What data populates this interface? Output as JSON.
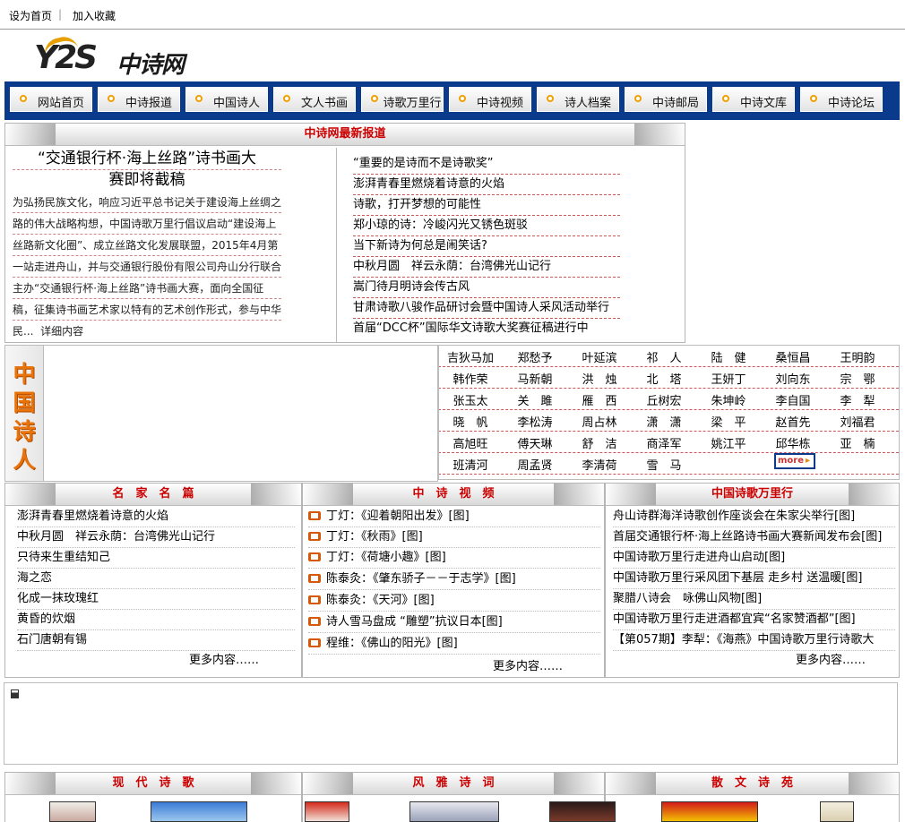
{
  "topbar": {
    "set_home": "设为首页",
    "sep": "|",
    "favorite": "加入收藏"
  },
  "logo": {
    "latin": "Y2S",
    "chinese": "中诗网"
  },
  "nav": [
    "网站首页",
    "中诗报道",
    "中国诗人",
    "文人书画",
    "诗歌万里行",
    "中诗视频",
    "诗人档案",
    "中诗邮局",
    "中诗文库",
    "中诗论坛"
  ],
  "news": {
    "title": "中诗网最新报道",
    "feature_title_1": "“交通银行杯·海上丝路”诗书画大",
    "feature_title_2": "赛即将截稿",
    "feature_lines": [
      "为弘扬民族文化，响应习近平总书记关于建设海上丝绸之",
      "路的伟大战略构想，中国诗歌万里行倡议启动“建设海上",
      "丝路新文化圈”、成立丝路文化发展联盟，2015年4月第",
      "一站走进舟山，并与交通银行股份有限公司舟山分行联合",
      "主办“交通银行杯·海上丝路”诗书画大赛，面向全国征",
      "稿，征集诗书画艺术家以特有的艺术创作形式，参与中华",
      "民..."
    ],
    "detail": "详细内容",
    "list": [
      "“重要的是诗而不是诗歌奖”",
      "澎湃青春里燃烧着诗意的火焰",
      "诗歌，打开梦想的可能性",
      "郑小琼的诗：冷峻闪光又锈色斑驳",
      "当下新诗为何总是闹笑话?",
      "中秋月圆　祥云永荫：台湾佛光山记行",
      "嵩门待月明诗会传古风",
      "甘肃诗歌八骏作品研讨会暨中国诗人采风活动举行",
      "首届“DCC杯”国际华文诗歌大奖赛征稿进行中"
    ]
  },
  "poets": {
    "label": [
      "中",
      "国",
      "诗",
      "人"
    ],
    "rows": [
      [
        "吉狄马加",
        "郑愁予",
        "叶延滨",
        "祁　人",
        "陆　健",
        "桑恒昌",
        "王明韵"
      ],
      [
        "韩作荣",
        "马新朝",
        "洪　烛",
        "北　塔",
        "王妍丁",
        "刘向东",
        "宗　鄂"
      ],
      [
        "张玉太",
        "关　雎",
        "雁　西",
        "丘树宏",
        "朱坤岭",
        "李自国",
        "李　犁"
      ],
      [
        "晓　帆",
        "李松涛",
        "周占林",
        "潇　潇",
        "梁　平",
        "赵首先",
        "刘福君"
      ],
      [
        "高旭旺",
        "傅天琳",
        "舒　洁",
        "商泽军",
        "姚江平",
        "邱华栋",
        "亚　楠"
      ],
      [
        "班清河",
        "周孟贤",
        "李清荷",
        "雪　马"
      ]
    ],
    "more": "more"
  },
  "masters": {
    "title": "名　家　名　篇",
    "items": [
      "澎湃青春里燃烧着诗意的火焰",
      "中秋月圆　祥云永荫：台湾佛光山记行",
      "只待来生重结知己",
      "海之恋",
      "化成一抹玫瑰红",
      "黄昏的炊烟",
      "石门唐朝有锡"
    ],
    "more": "更多内容……"
  },
  "videos": {
    "title": "中　诗　视　频",
    "items": [
      "丁灯：《迎着朝阳出发》[图]",
      "丁灯：《秋雨》[图]",
      "丁灯：《荷塘小趣》[图]",
      "陈泰灸：《肇东骄子－－于志学》[图]",
      "陈泰灸：《天河》[图]",
      "诗人雪马盘成 “雕塑”抗议日本[图]",
      "程维：《佛山的阳光》[图]"
    ],
    "more": "更多内容……"
  },
  "travel": {
    "title": "中国诗歌万里行",
    "items": [
      "舟山诗群海洋诗歌创作座谈会在朱家尖举行[图]",
      "首届交通银行杯·海上丝路诗书画大赛新闻发布会[图]",
      "中国诗歌万里行走进舟山启动[图]",
      "中国诗歌万里行采风团下基层 走乡村 送温暖[图]",
      "聚腊八诗会　咏佛山风物[图]",
      "中国诗歌万里行走进酒都宜宾“名家赞酒都”[图]",
      "【第057期】李犁：《海燕》中国诗歌万里行诗歌大"
    ],
    "more": "更多内容……"
  },
  "bottom": {
    "modern": "现　代　诗　歌",
    "fengya": "风　雅　诗　词",
    "prose": "散　文　诗　苑"
  },
  "colors": {
    "nav_bg": "#0a3a8c",
    "heading_red": "#cc0000",
    "poet_label": "#e8730a"
  }
}
